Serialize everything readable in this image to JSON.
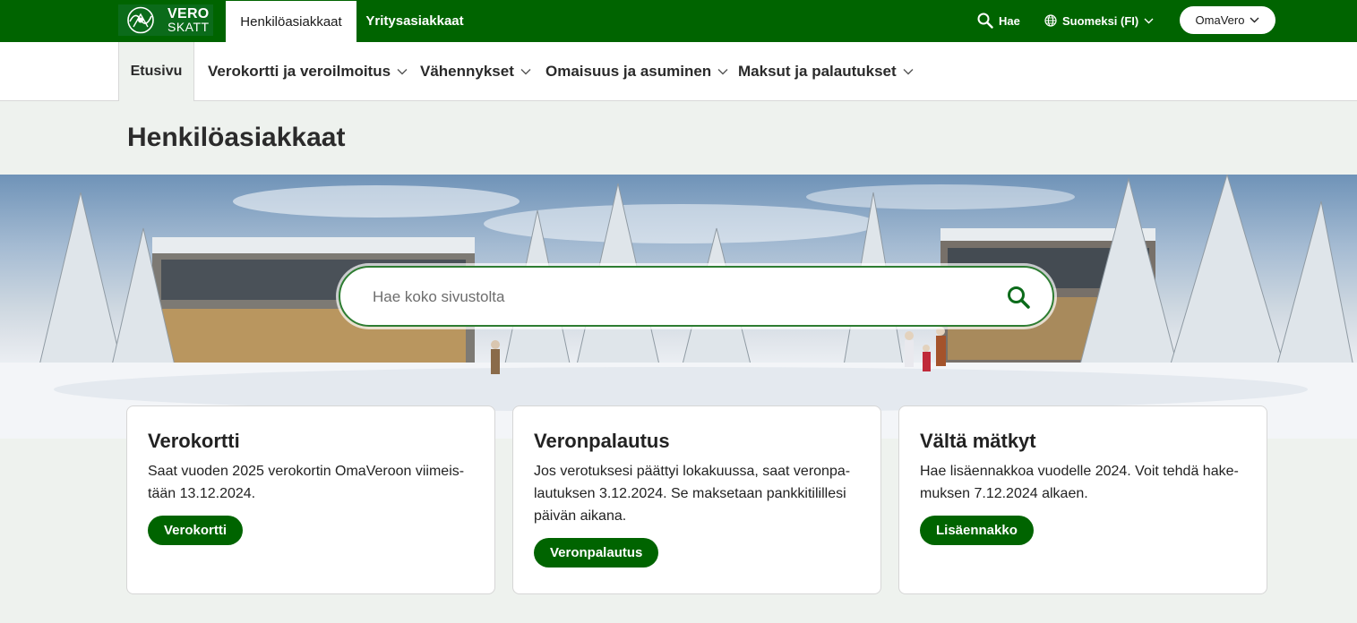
{
  "logo": {
    "line1": "VERO",
    "line2": "SKATT"
  },
  "topbar": {
    "tabs": [
      {
        "label": "Henkilöasiakkaat",
        "active": true
      },
      {
        "label": "Yritysasiakkaat",
        "active": false
      }
    ],
    "search_label": "Hae",
    "language_label": "Suomeksi (FI)",
    "omavero_label": "OmaVero"
  },
  "mainnav": {
    "home_label": "Etusivu",
    "items": [
      {
        "label": "Verokortti ja veroilmoitus"
      },
      {
        "label": "Vähennykset"
      },
      {
        "label": "Omaisuus ja asuminen"
      },
      {
        "label": "Maksut ja palautukset"
      }
    ]
  },
  "page": {
    "title": "Henkilöasiakkaat"
  },
  "search": {
    "placeholder": "Hae koko sivustolta"
  },
  "cards": [
    {
      "title": "Verokortti",
      "text": "Saat vuoden 2025 verokortin OmaVeroon viimeis-tään 13.12.2024.",
      "button": "Verokortti"
    },
    {
      "title": "Veronpalautus",
      "text": "Jos verotuksesi päättyi lokakuussa, saat veronpa-lautuksen 3.12.2024. Se maksetaan pankkitilillesi päivän aikana.",
      "button": "Veronpalautus"
    },
    {
      "title": "Vältä mätkyt",
      "text": "Hae lisäennakkoa vuodelle 2024. Voit tehdä hake-muksen 7.12.2024 alkaen.",
      "button": "Lisäennakko"
    }
  ],
  "colors": {
    "brand_green": "#006400",
    "page_background": "#eef2ee"
  }
}
